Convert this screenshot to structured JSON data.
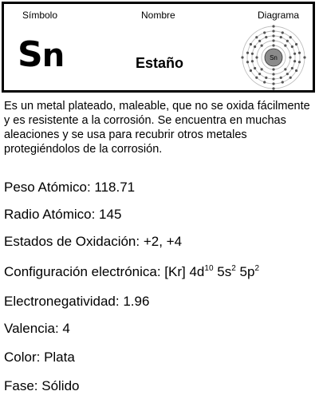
{
  "header": {
    "symbol_label": "Símbolo",
    "name_label": "Nombre",
    "diagram_label": "Diagrama"
  },
  "element": {
    "symbol_first": "S",
    "symbol_rest": "n",
    "name": "Estaño",
    "diagram_nucleus": "Sn",
    "shell_electrons": [
      2,
      8,
      18,
      18,
      4
    ]
  },
  "description": "Es un metal plateado, maleable, que no se oxida fácilmente y es resistente a la corrosión. Se encuentra en muchas aleaciones y se usa para recubrir otros metales protegiéndolos de la corrosión.",
  "properties": {
    "atomic_weight": "Peso Atómico: 118.71",
    "atomic_radius": "Radio Atómico: 145",
    "oxidation_states": "Estados de Oxidación: +2, +4",
    "config_label": "Configuración electrónica:",
    "config_core": "[Kr] 4d",
    "config_d_exp": "10",
    "config_s": "5s",
    "config_s_exp": "2",
    "config_p": "5p",
    "config_p_exp": "2",
    "electronegativity": "Electronegatividad: 1.96",
    "valence": "Valencia: 4",
    "color": "Color: Plata",
    "phase": "Fase: Sólido"
  }
}
